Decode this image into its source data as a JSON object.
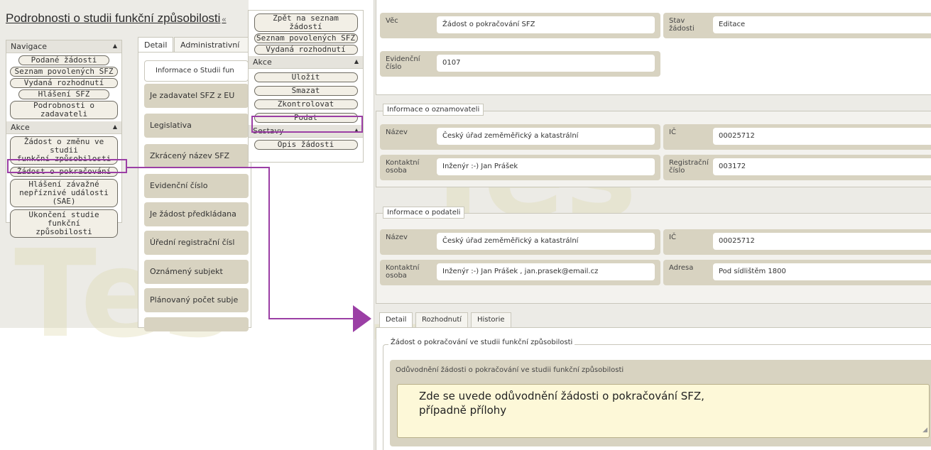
{
  "page": {
    "title": "Podrobnosti o studii funkční způsobilosti",
    "title_suffix": "«"
  },
  "navigation_panel": {
    "header": "Navigace",
    "items": [
      {
        "label": "Podané žádosti"
      },
      {
        "label": "Seznam povolených SFZ"
      },
      {
        "label": "Vydaná rozhodnutí"
      },
      {
        "label": "Hlášení SFZ"
      },
      {
        "label": "Podrobnosti o zadavateli"
      }
    ],
    "actions_header": "Akce",
    "actions": [
      {
        "line1": "Žádost o změnu ve studii",
        "line2": "funkční způsobilosti"
      },
      {
        "line1": "Žádost o pokračování",
        "line2": ""
      },
      {
        "line1": "Hlášení závažné",
        "line2": "nepříznivé události (SAE)"
      },
      {
        "line1": "Ukončení studie funkční",
        "line2": "způsobilosti"
      }
    ]
  },
  "left_detail": {
    "tabs": [
      "Detail",
      "Administrativní"
    ],
    "fieldset_legend": "Informace o Studii fun",
    "fields": [
      "Je zadavatel SFZ z EU",
      "Legislativa",
      "Zkrácený název SFZ",
      "Evidenční číslo",
      "Je žádost předkládana",
      "Úřední registrační čísl",
      "Oznámený subjekt",
      "Plánovaný počet subje"
    ]
  },
  "action_panel": {
    "links": [
      "Zpět na seznam žádostí",
      "Seznam povolených SFZ",
      "Vydaná rozhodnutí"
    ],
    "actions_header": "Akce",
    "actions": [
      "Uložit",
      "Smazat",
      "Zkontrolovat",
      "Podat"
    ],
    "reports_header": "Sestavy",
    "reports": [
      "Opis žádosti"
    ]
  },
  "top_section": {
    "vec_label": "Věc",
    "vec_value": "Žádost o pokračování SFZ",
    "stav_label_line1": "Stav",
    "stav_label_line2": "žádosti",
    "stav_value": "Editace",
    "evid_label_line1": "Evidenční",
    "evid_label_line2": "číslo",
    "evid_value": "0107"
  },
  "oznamovatel": {
    "legend": "Informace o oznamovateli",
    "nazev_label": "Název",
    "nazev_value": "Český úřad zeměměřický a katastrální",
    "ic_label": "IČ",
    "ic_value": "00025712",
    "kontakt_label_line1": "Kontaktní",
    "kontakt_label_line2": "osoba",
    "kontakt_value": "Inženýr :-) Jan Prášek",
    "reg_label_line1": "Registrační",
    "reg_label_line2": "číslo",
    "reg_value": "003172"
  },
  "podatel": {
    "legend": "Informace o podateli",
    "nazev_label": "Název",
    "nazev_value": "Český úřad zeměměřický a katastrální",
    "ic_label": "IČ",
    "ic_value": "00025712",
    "kontakt_label_line1": "Kontaktní",
    "kontakt_label_line2": "osoba",
    "kontakt_value": "Inženýr :-) Jan Prášek , jan.prasek@email.cz",
    "adresa_label": "Adresa",
    "adresa_value": "Pod sídlištěm 1800"
  },
  "bottom": {
    "tabs": [
      "Detail",
      "Rozhodnutí",
      "Historie"
    ],
    "legend": "Žádost o pokračování ve studii funkční způsobilosti",
    "field_label": "Odůvodnění žádosti o pokračování ve studii funkční způsobilosti",
    "textarea_line1": "Zde se uvede odůvodnění žádosti o pokračování SFZ,",
    "textarea_line2": "případně přílohy"
  },
  "watermark": "Tes",
  "colors": {
    "highlight": "#9b3fa5",
    "field_bg": "#d8d3c1",
    "textarea_bg": "#fdf8d8",
    "panel_bg": "#ecebe6"
  }
}
